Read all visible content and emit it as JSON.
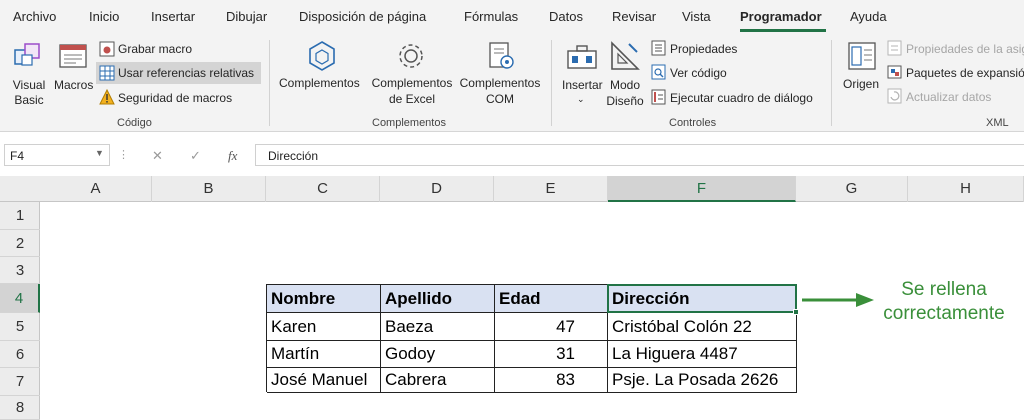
{
  "tabs": [
    "Archivo",
    "Inicio",
    "Insertar",
    "Dibujar",
    "Disposición de página",
    "Fórmulas",
    "Datos",
    "Revisar",
    "Vista",
    "Programador",
    "Ayuda"
  ],
  "active_tab": "Programador",
  "ribbon": {
    "codigo": {
      "visual_basic_line1": "Visual",
      "visual_basic_line2": "Basic",
      "macros": "Macros",
      "grabar_macro": "Grabar macro",
      "usar_referencias": "Usar referencias relativas",
      "seguridad": "Seguridad de macros",
      "label": "Código"
    },
    "complementos": {
      "complementos": "Complementos",
      "excel_line1": "Complementos",
      "excel_line2": "de Excel",
      "com_line1": "Complementos",
      "com_line2": "COM",
      "label": "Complementos"
    },
    "controles": {
      "insertar": "Insertar",
      "modo_line1": "Modo",
      "modo_line2": "Diseño",
      "propiedades": "Propiedades",
      "ver_codigo": "Ver código",
      "ejecutar": "Ejecutar cuadro de diálogo",
      "label": "Controles"
    },
    "xml": {
      "origen": "Origen",
      "propiedades_asig": "Propiedades de la asig",
      "paquetes": "Paquetes de expansión",
      "actualizar": "Actualizar datos",
      "label": "XML"
    }
  },
  "formula_bar": {
    "name_box": "F4",
    "cancel": "✕",
    "enter": "✓",
    "fx": "fx",
    "content": "Dirección"
  },
  "columns": [
    "A",
    "B",
    "C",
    "D",
    "E",
    "F",
    "G",
    "H"
  ],
  "selected_column": "F",
  "rows": [
    "1",
    "2",
    "3",
    "4",
    "5",
    "6",
    "7",
    "8"
  ],
  "selected_row": "4",
  "table": {
    "headers": [
      "Nombre",
      "Apellido",
      "Edad",
      "Dirección"
    ],
    "rows": [
      [
        "Karen",
        "Baeza",
        "47",
        "Cristóbal Colón 22"
      ],
      [
        "Martín",
        "Godoy",
        "31",
        "La Higuera 4487"
      ],
      [
        "José Manuel",
        "Cabrera",
        "83",
        "Psje. La Posada 2626"
      ]
    ]
  },
  "annotation": {
    "line1": "Se rellena",
    "line2": "correctamente",
    "color": "#3a8f3a"
  },
  "colors": {
    "accent": "#217346",
    "header_fill": "#d9e1f2"
  }
}
